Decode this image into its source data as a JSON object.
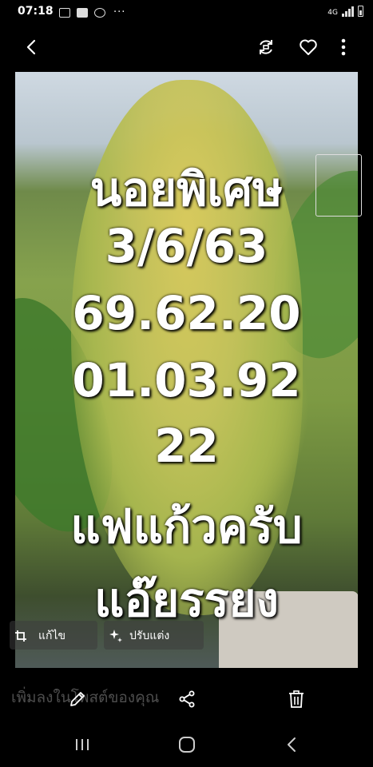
{
  "status_bar": {
    "time": "07:18",
    "network_label": "4G",
    "more_glyph": "···"
  },
  "image_text": {
    "line1": "นอยพิเศษ",
    "line2": "3/6/63",
    "line3": "69.62.20",
    "line4": "01.03.92",
    "line5": "22",
    "line6": "แฟแก้วครับ",
    "line7": "แอ๊ยรรยง"
  },
  "edit_bar": {
    "edit_label": "แก้ไข",
    "adjust_label": "ปรับแต่ง"
  },
  "caption": {
    "placeholder": "เพิ่มลงในโพสต์ของคุณ"
  },
  "icons": {
    "back": "back-arrow-icon",
    "rotate": "rotate-icon",
    "like": "heart-icon",
    "menu": "more-vert-icon",
    "crop": "crop-icon",
    "sparkle": "sparkle-icon",
    "pencil": "pencil-icon",
    "share": "share-icon",
    "trash": "trash-icon",
    "recents": "recents-icon",
    "home": "home-icon",
    "nav_back": "nav-back-icon"
  }
}
